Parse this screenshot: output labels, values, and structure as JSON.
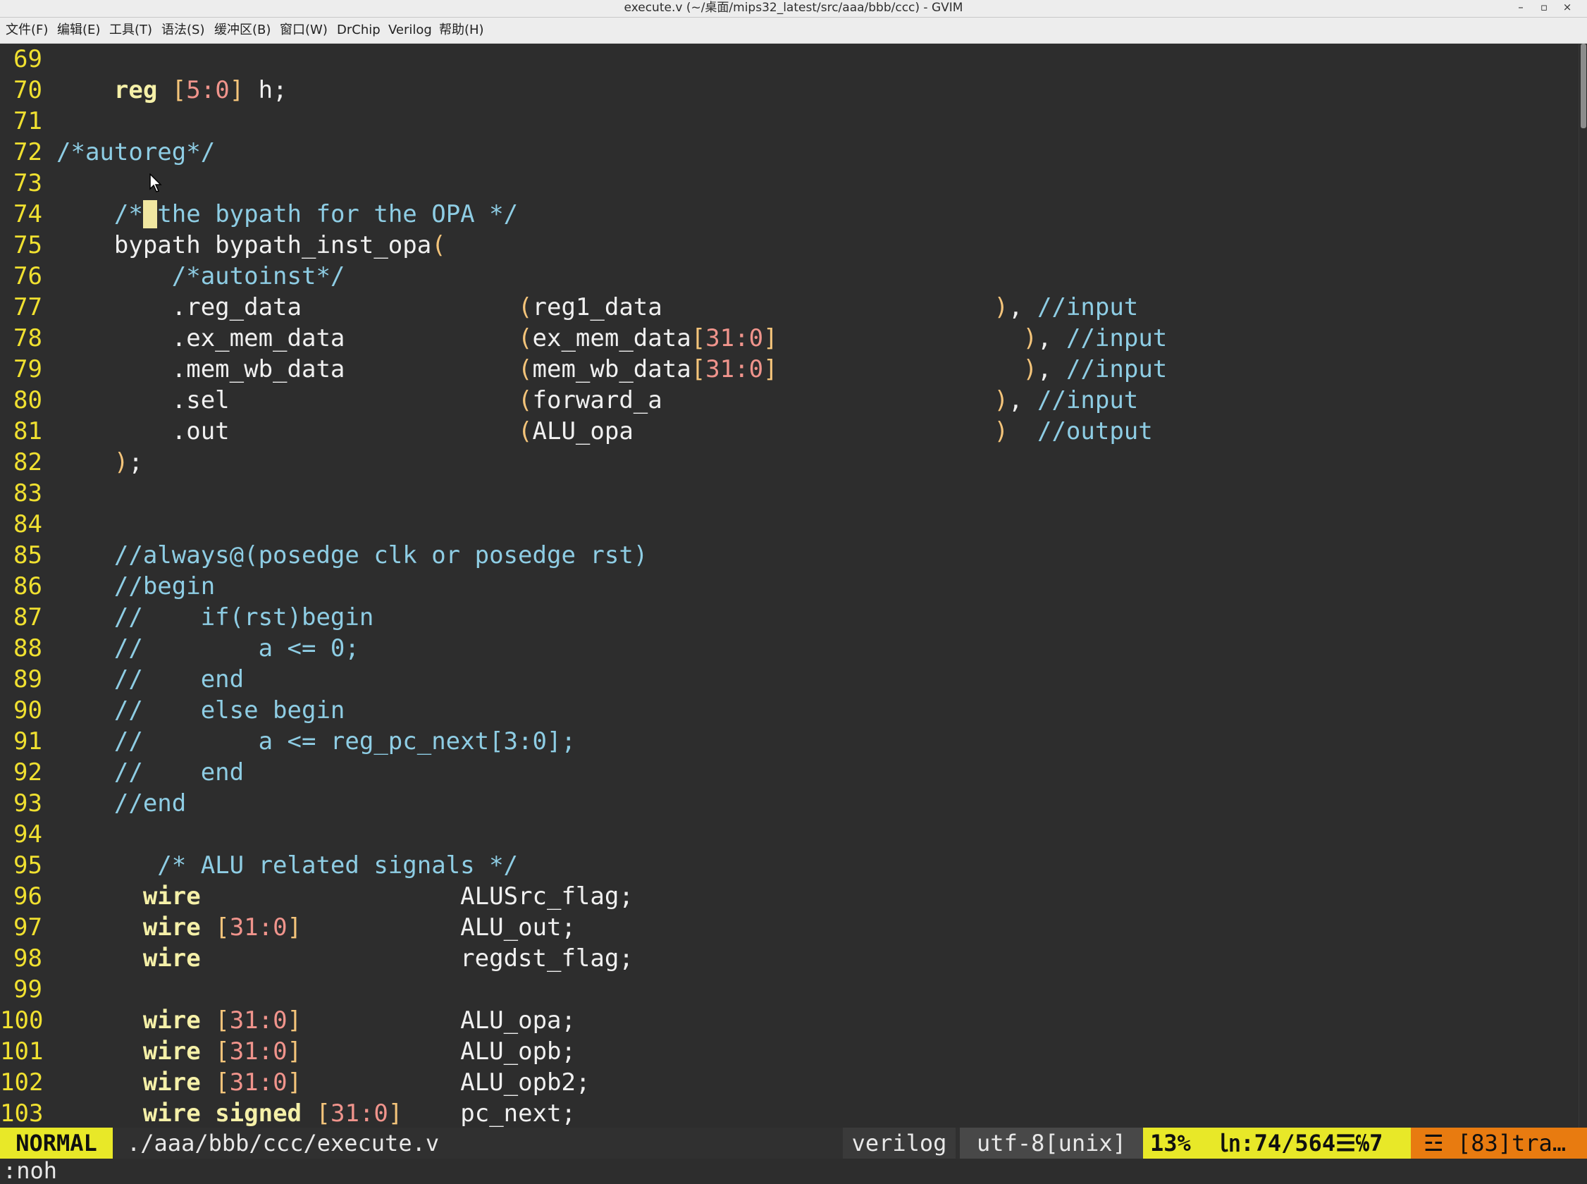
{
  "window": {
    "title": "execute.v (~/桌面/mips32_latest/src/aaa/bbb/ccc) - GVIM",
    "minimize": "–",
    "maximize": "▫",
    "close": "×"
  },
  "menu": [
    "文件(F)",
    "编辑(E)",
    "工具(T)",
    "语法(S)",
    "缓冲区(B)",
    "窗口(W)",
    "DrChip",
    "Verilog",
    "帮助(H)"
  ],
  "editor": {
    "cursor_line": 74,
    "lines": [
      {
        "n": "69",
        "tokens": []
      },
      {
        "n": "70",
        "tokens": [
          [
            "txt",
            "    "
          ],
          [
            "kw",
            "reg"
          ],
          [
            "txt",
            " "
          ],
          [
            "br",
            "["
          ],
          [
            "num",
            "5:0"
          ],
          [
            "br",
            "]"
          ],
          [
            "txt",
            " h;"
          ]
        ]
      },
      {
        "n": "71",
        "tokens": []
      },
      {
        "n": "72",
        "tokens": [
          [
            "cmt",
            "/*autoreg*/"
          ]
        ]
      },
      {
        "n": "73",
        "tokens": []
      },
      {
        "n": "74",
        "tokens": [
          [
            "cmt",
            "    /*"
          ],
          [
            "cur",
            " "
          ],
          [
            "cmt",
            "the bypath for the OPA */"
          ]
        ]
      },
      {
        "n": "75",
        "tokens": [
          [
            "txt",
            "    bypath bypath_inst_opa"
          ],
          [
            "br",
            "("
          ]
        ]
      },
      {
        "n": "76",
        "tokens": [
          [
            "cmt",
            "        /*autoinst*/"
          ]
        ]
      },
      {
        "n": "77",
        "tokens": [
          [
            "txt",
            "        .reg_data               "
          ],
          [
            "br",
            "("
          ],
          [
            "txt",
            "reg1_data                       "
          ],
          [
            "br",
            ")"
          ],
          [
            "txt",
            ", "
          ],
          [
            "cmt",
            "//input"
          ]
        ]
      },
      {
        "n": "78",
        "tokens": [
          [
            "txt",
            "        .ex_mem_data            "
          ],
          [
            "br",
            "("
          ],
          [
            "txt",
            "ex_mem_data"
          ],
          [
            "br",
            "["
          ],
          [
            "num",
            "31:0"
          ],
          [
            "br",
            "]"
          ],
          [
            "txt",
            "                 "
          ],
          [
            "br",
            ")"
          ],
          [
            "txt",
            ", "
          ],
          [
            "cmt",
            "//input"
          ]
        ]
      },
      {
        "n": "79",
        "tokens": [
          [
            "txt",
            "        .mem_wb_data            "
          ],
          [
            "br",
            "("
          ],
          [
            "txt",
            "mem_wb_data"
          ],
          [
            "br",
            "["
          ],
          [
            "num",
            "31:0"
          ],
          [
            "br",
            "]"
          ],
          [
            "txt",
            "                 "
          ],
          [
            "br",
            ")"
          ],
          [
            "txt",
            ", "
          ],
          [
            "cmt",
            "//input"
          ]
        ]
      },
      {
        "n": "80",
        "tokens": [
          [
            "txt",
            "        .sel                    "
          ],
          [
            "br",
            "("
          ],
          [
            "txt",
            "forward_a                       "
          ],
          [
            "br",
            ")"
          ],
          [
            "txt",
            ", "
          ],
          [
            "cmt",
            "//input"
          ]
        ]
      },
      {
        "n": "81",
        "tokens": [
          [
            "txt",
            "        .out                    "
          ],
          [
            "br",
            "("
          ],
          [
            "txt",
            "ALU_opa                         "
          ],
          [
            "br",
            ")"
          ],
          [
            "txt",
            "  "
          ],
          [
            "cmt",
            "//output"
          ]
        ]
      },
      {
        "n": "82",
        "tokens": [
          [
            "txt",
            "    "
          ],
          [
            "br",
            ")"
          ],
          [
            "txt",
            ";"
          ]
        ]
      },
      {
        "n": "83",
        "tokens": []
      },
      {
        "n": "84",
        "tokens": []
      },
      {
        "n": "85",
        "tokens": [
          [
            "cmt",
            "    //always@(posedge clk or posedge rst)"
          ]
        ]
      },
      {
        "n": "86",
        "tokens": [
          [
            "cmt",
            "    //begin"
          ]
        ]
      },
      {
        "n": "87",
        "tokens": [
          [
            "cmt",
            "    //    if(rst)begin"
          ]
        ]
      },
      {
        "n": "88",
        "tokens": [
          [
            "cmt",
            "    //        a <= 0;"
          ]
        ]
      },
      {
        "n": "89",
        "tokens": [
          [
            "cmt",
            "    //    end"
          ]
        ]
      },
      {
        "n": "90",
        "tokens": [
          [
            "cmt",
            "    //    else begin"
          ]
        ]
      },
      {
        "n": "91",
        "tokens": [
          [
            "cmt",
            "    //        a <= reg_pc_next[3:0];"
          ]
        ]
      },
      {
        "n": "92",
        "tokens": [
          [
            "cmt",
            "    //    end"
          ]
        ]
      },
      {
        "n": "93",
        "tokens": [
          [
            "cmt",
            "    //end"
          ]
        ]
      },
      {
        "n": "94",
        "tokens": []
      },
      {
        "n": "95",
        "tokens": [
          [
            "cmt",
            "       /* ALU related signals */"
          ]
        ]
      },
      {
        "n": "96",
        "tokens": [
          [
            "txt",
            "      "
          ],
          [
            "kw",
            "wire"
          ],
          [
            "txt",
            "                  ALUSrc_flag;"
          ]
        ]
      },
      {
        "n": "97",
        "tokens": [
          [
            "txt",
            "      "
          ],
          [
            "kw",
            "wire"
          ],
          [
            "txt",
            " "
          ],
          [
            "br",
            "["
          ],
          [
            "num",
            "31:0"
          ],
          [
            "br",
            "]"
          ],
          [
            "txt",
            "           ALU_out;"
          ]
        ]
      },
      {
        "n": "98",
        "tokens": [
          [
            "txt",
            "      "
          ],
          [
            "kw",
            "wire"
          ],
          [
            "txt",
            "                  regdst_flag;"
          ]
        ]
      },
      {
        "n": "99",
        "tokens": []
      },
      {
        "n": "100",
        "tokens": [
          [
            "txt",
            "      "
          ],
          [
            "kw",
            "wire"
          ],
          [
            "txt",
            " "
          ],
          [
            "br",
            "["
          ],
          [
            "num",
            "31:0"
          ],
          [
            "br",
            "]"
          ],
          [
            "txt",
            "           ALU_opa;"
          ]
        ]
      },
      {
        "n": "101",
        "tokens": [
          [
            "txt",
            "      "
          ],
          [
            "kw",
            "wire"
          ],
          [
            "txt",
            " "
          ],
          [
            "br",
            "["
          ],
          [
            "num",
            "31:0"
          ],
          [
            "br",
            "]"
          ],
          [
            "txt",
            "           ALU_opb;"
          ]
        ]
      },
      {
        "n": "102",
        "tokens": [
          [
            "txt",
            "      "
          ],
          [
            "kw",
            "wire"
          ],
          [
            "txt",
            " "
          ],
          [
            "br",
            "["
          ],
          [
            "num",
            "31:0"
          ],
          [
            "br",
            "]"
          ],
          [
            "txt",
            "           ALU_opb2;"
          ]
        ]
      },
      {
        "n": "103",
        "tokens": [
          [
            "txt",
            "      "
          ],
          [
            "kw",
            "wire"
          ],
          [
            "txt",
            " "
          ],
          [
            "kw",
            "signed"
          ],
          [
            "txt",
            " "
          ],
          [
            "br",
            "["
          ],
          [
            "num",
            "31:0"
          ],
          [
            "br",
            "]"
          ],
          [
            "txt",
            "    pc_next;"
          ]
        ]
      }
    ]
  },
  "status": {
    "mode": "NORMAL",
    "file": "./aaa/bbb/ccc/execute.v",
    "filetype": "verilog",
    "encoding": "utf-8[unix]",
    "position": "13%  ㏑:74/564☰℅7",
    "warning": "☲ [83]tra…"
  },
  "cmdline": ":noh",
  "colors": {
    "background": "#2d2d2d",
    "line_number": "#f0e030",
    "keyword": "#f5f0a8",
    "number": "#f0948c",
    "comment": "#8ecde4",
    "mode_bg": "#e8e828",
    "warning_bg": "#e87b10"
  }
}
